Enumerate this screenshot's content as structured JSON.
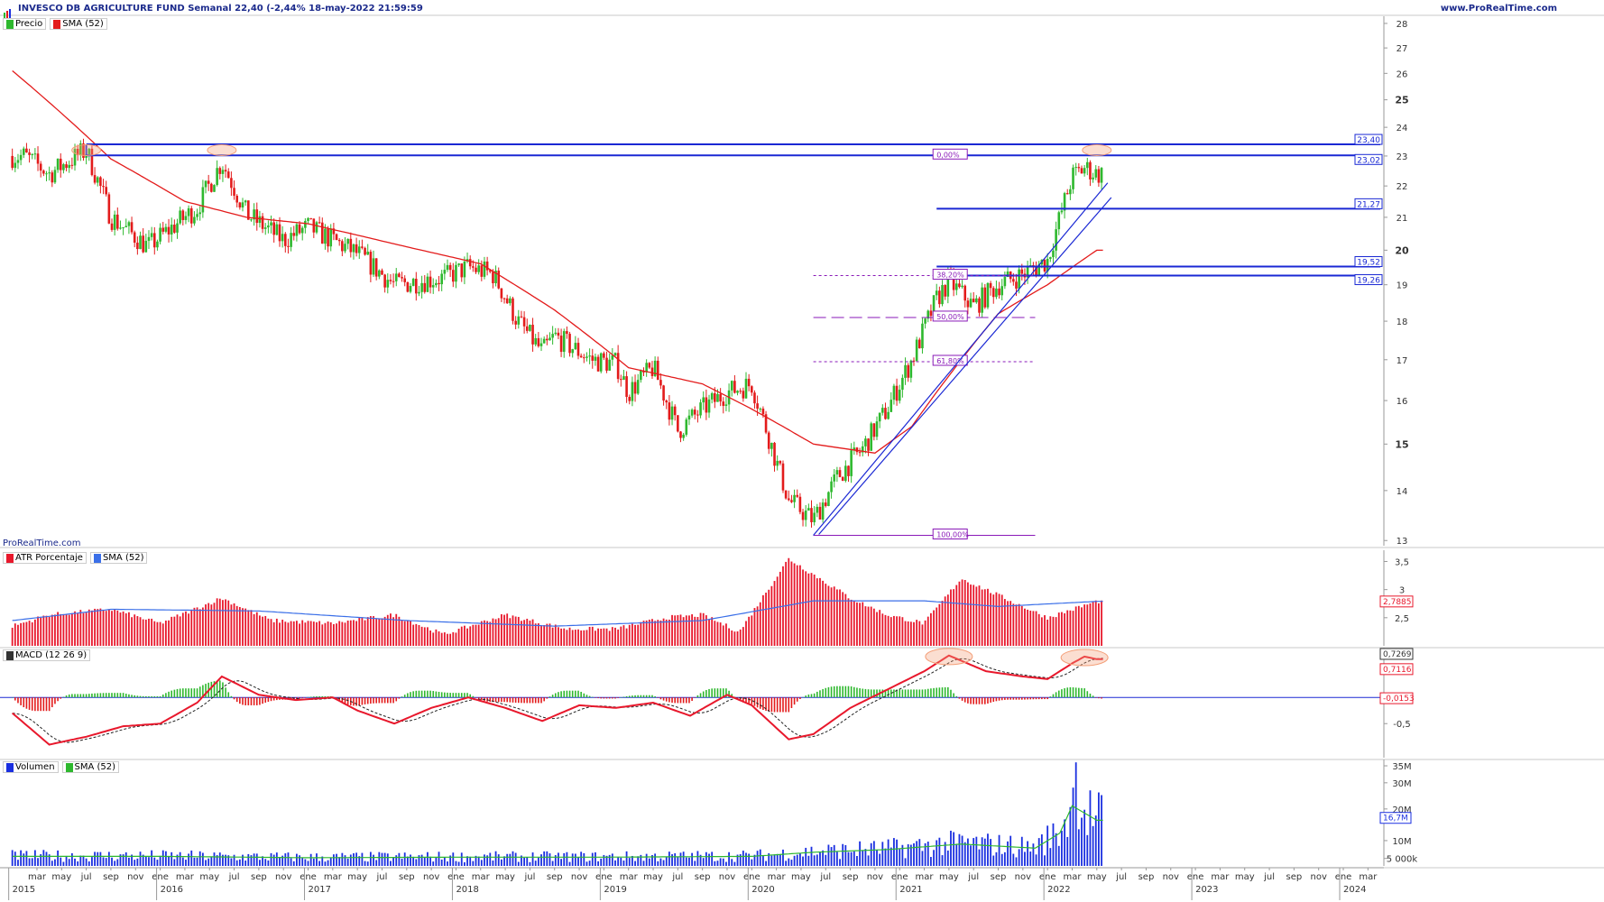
{
  "header": {
    "title": "INVESCO DB AGRICULTURE FUND Semanal 22,40 (-2,44% 18-may-2022 21:59:59",
    "credit": "www.ProRealTime.com",
    "watermark": "ProRealTime.com"
  },
  "colors": {
    "axis_text": "#333333",
    "frame": "#1b2a8c",
    "sma_price": "#e31b1b",
    "up_candle": "#2eb82e",
    "down_candle": "#e31b1b",
    "atr_bar": "#e8182c",
    "atr_sma": "#3a6fe8",
    "macd_line": "#e8182c",
    "signal_line": "#222222",
    "volume_bar": "#1a2fe0",
    "volume_sma": "#2eb82e",
    "level_line": "#1a28d4",
    "fib_line": "#8a1ab8",
    "highlight": "#f4a07a"
  },
  "legends": {
    "price": [
      {
        "label": "Precio",
        "color": "#2eb82e"
      },
      {
        "label": "SMA (52)",
        "color": "#e31b1b"
      }
    ],
    "atr": [
      {
        "label": "ATR Porcentaje",
        "color": "#e8182c"
      },
      {
        "label": "SMA (52)",
        "color": "#3a6fe8"
      }
    ],
    "macd": [
      {
        "label": "MACD (12 26 9)",
        "color": "#333333"
      }
    ],
    "volume": [
      {
        "label": "Volumen",
        "color": "#1a2fe0"
      },
      {
        "label": "SMA (52)",
        "color": "#2eb82e"
      }
    ]
  },
  "chart_data": [
    {
      "type": "candlestick",
      "panel": "price",
      "title": "INVESCO DB AGRICULTURE FUND Semanal",
      "last_close": 22.4,
      "change_pct": -2.44,
      "date": "18-may-2022 21:59:59",
      "y_scale": "log",
      "ylim": [
        12.9,
        28.3
      ],
      "y_ticks": [
        13,
        14,
        15,
        16,
        17,
        18,
        19,
        20,
        21,
        22,
        23,
        24,
        25,
        26,
        27,
        28
      ],
      "y_ticks_bold": [
        15,
        20,
        25
      ],
      "y_tick_labels": [
        "13",
        "14",
        "15",
        "16",
        "17",
        "18",
        "19",
        "20",
        "21",
        "22",
        "23",
        "24",
        "25",
        "26",
        "27",
        "28"
      ],
      "close_anchors": [
        {
          "date": "2015-02",
          "close": 23.0
        },
        {
          "date": "2015-04",
          "close": 22.4
        },
        {
          "date": "2015-07",
          "close": 23.2
        },
        {
          "date": "2015-09",
          "close": 21.0
        },
        {
          "date": "2015-12",
          "close": 20.1
        },
        {
          "date": "2016-04",
          "close": 21.3
        },
        {
          "date": "2016-06",
          "close": 22.8
        },
        {
          "date": "2016-08",
          "close": 21.1
        },
        {
          "date": "2016-11",
          "close": 20.3
        },
        {
          "date": "2017-01",
          "close": 20.7
        },
        {
          "date": "2017-05",
          "close": 19.9
        },
        {
          "date": "2017-08",
          "close": 19.0
        },
        {
          "date": "2017-12",
          "close": 19.2
        },
        {
          "date": "2018-02",
          "close": 19.5
        },
        {
          "date": "2018-04",
          "close": 19.3
        },
        {
          "date": "2018-06",
          "close": 18.0
        },
        {
          "date": "2018-08",
          "close": 17.2
        },
        {
          "date": "2018-09",
          "close": 17.6
        },
        {
          "date": "2018-12",
          "close": 17.0
        },
        {
          "date": "2019-02",
          "close": 16.9
        },
        {
          "date": "2019-03",
          "close": 16.2
        },
        {
          "date": "2019-05",
          "close": 16.8
        },
        {
          "date": "2019-07",
          "close": 15.3
        },
        {
          "date": "2019-09",
          "close": 15.8
        },
        {
          "date": "2019-11",
          "close": 16.2
        },
        {
          "date": "2020-01",
          "close": 16.4
        },
        {
          "date": "2020-03",
          "close": 14.6
        },
        {
          "date": "2020-04",
          "close": 13.8
        },
        {
          "date": "2020-06",
          "close": 13.4
        },
        {
          "date": "2020-08",
          "close": 14.3
        },
        {
          "date": "2020-10",
          "close": 14.9
        },
        {
          "date": "2020-12",
          "close": 15.8
        },
        {
          "date": "2021-02",
          "close": 17.0
        },
        {
          "date": "2021-04",
          "close": 18.6
        },
        {
          "date": "2021-05",
          "close": 19.1
        },
        {
          "date": "2021-07",
          "close": 18.4
        },
        {
          "date": "2021-09",
          "close": 19.0
        },
        {
          "date": "2021-11",
          "close": 19.3
        },
        {
          "date": "2022-01",
          "close": 19.7
        },
        {
          "date": "2022-03",
          "close": 22.3
        },
        {
          "date": "2022-04",
          "close": 22.6
        },
        {
          "date": "2022-05",
          "close": 22.4
        }
      ],
      "sma52_anchors": [
        {
          "date": "2015-01",
          "value": 26.1
        },
        {
          "date": "2015-09",
          "value": 22.9
        },
        {
          "date": "2016-03",
          "value": 21.5
        },
        {
          "date": "2016-08",
          "value": 21.0
        },
        {
          "date": "2017-01",
          "value": 20.8
        },
        {
          "date": "2017-09",
          "value": 20.1
        },
        {
          "date": "2018-03",
          "value": 19.6
        },
        {
          "date": "2018-09",
          "value": 18.3
        },
        {
          "date": "2019-03",
          "value": 16.8
        },
        {
          "date": "2019-09",
          "value": 16.4
        },
        {
          "date": "2020-01",
          "value": 15.8
        },
        {
          "date": "2020-06",
          "value": 15.0
        },
        {
          "date": "2020-11",
          "value": 14.8
        },
        {
          "date": "2021-02",
          "value": 15.4
        },
        {
          "date": "2021-05",
          "value": 16.6
        },
        {
          "date": "2021-09",
          "value": 18.2
        },
        {
          "date": "2022-01",
          "value": 19.0
        },
        {
          "date": "2022-05",
          "value": 20.0
        }
      ],
      "levels": [
        {
          "value": 23.4,
          "label": "23,40",
          "kind": "resistance"
        },
        {
          "value": 23.02,
          "label": "23,02",
          "kind": "resistance"
        },
        {
          "value": 21.27,
          "label": "21,27",
          "kind": "support"
        },
        {
          "value": 19.52,
          "label": "19,52",
          "kind": "support"
        },
        {
          "value": 19.26,
          "label": "19,26",
          "kind": "support"
        }
      ],
      "fibonacci": [
        {
          "label": "0,00%",
          "value": 23.02
        },
        {
          "label": "38,20%",
          "value": 19.26
        },
        {
          "label": "50,00%",
          "value": 18.1
        },
        {
          "label": "61,80%",
          "value": 16.95
        },
        {
          "label": "100,00%",
          "value": 13.1
        }
      ],
      "trend_channel": [
        {
          "from": {
            "date": "2020-06",
            "value": 13.1
          },
          "to": {
            "date": "2022-05",
            "value": 22.1
          }
        },
        {
          "from": {
            "date": "2020-06",
            "value": 13.1
          },
          "to": {
            "date": "2022-05",
            "value": 21.8
          }
        }
      ],
      "highlights": [
        "2015-07",
        "2016-06",
        "2022-05"
      ]
    },
    {
      "type": "bar",
      "panel": "atr",
      "title": "ATR Porcentaje",
      "last_value": 2.7885,
      "last_label": "2,7885",
      "ylim": [
        2.0,
        3.7
      ],
      "y_ticks": [
        2.5,
        3,
        3.5
      ],
      "y_tick_labels": [
        "2,5",
        "3",
        "3,5"
      ],
      "anchors": [
        {
          "date": "2015-01",
          "value": 2.35
        },
        {
          "date": "2015-04",
          "value": 2.55
        },
        {
          "date": "2015-09",
          "value": 2.65
        },
        {
          "date": "2016-01",
          "value": 2.4
        },
        {
          "date": "2016-06",
          "value": 2.85
        },
        {
          "date": "2016-10",
          "value": 2.45
        },
        {
          "date": "2017-03",
          "value": 2.4
        },
        {
          "date": "2017-08",
          "value": 2.55
        },
        {
          "date": "2017-12",
          "value": 2.2
        },
        {
          "date": "2018-05",
          "value": 2.55
        },
        {
          "date": "2018-10",
          "value": 2.3
        },
        {
          "date": "2019-02",
          "value": 2.3
        },
        {
          "date": "2019-06",
          "value": 2.5
        },
        {
          "date": "2019-09",
          "value": 2.55
        },
        {
          "date": "2019-12",
          "value": 2.25
        },
        {
          "date": "2020-04",
          "value": 3.55
        },
        {
          "date": "2020-09",
          "value": 2.85
        },
        {
          "date": "2020-12",
          "value": 2.55
        },
        {
          "date": "2021-03",
          "value": 2.4
        },
        {
          "date": "2021-06",
          "value": 3.2
        },
        {
          "date": "2021-10",
          "value": 2.8
        },
        {
          "date": "2022-01",
          "value": 2.5
        },
        {
          "date": "2022-05",
          "value": 2.79
        }
      ],
      "sma52_anchors": [
        {
          "date": "2015-01",
          "value": 2.45
        },
        {
          "date": "2015-09",
          "value": 2.65
        },
        {
          "date": "2016-09",
          "value": 2.62
        },
        {
          "date": "2017-09",
          "value": 2.45
        },
        {
          "date": "2018-09",
          "value": 2.35
        },
        {
          "date": "2019-09",
          "value": 2.45
        },
        {
          "date": "2020-06",
          "value": 2.8
        },
        {
          "date": "2021-03",
          "value": 2.8
        },
        {
          "date": "2021-09",
          "value": 2.7
        },
        {
          "date": "2022-05",
          "value": 2.79
        }
      ]
    },
    {
      "type": "line",
      "panel": "macd",
      "title": "MACD (12 26 9)",
      "values_labels": [
        "0,7269",
        "0,7116",
        "-0,0153"
      ],
      "macd_last": 0.7269,
      "signal_last": 0.7116,
      "histogram_last": -0.0153,
      "ylim": [
        -1.15,
        0.95
      ],
      "y_ticks": [
        -0.5
      ],
      "y_tick_labels": [
        "-0,5"
      ],
      "macd_anchors": [
        {
          "date": "2015-01",
          "value": -0.3
        },
        {
          "date": "2015-04",
          "value": -0.9
        },
        {
          "date": "2015-07",
          "value": -0.75
        },
        {
          "date": "2015-10",
          "value": -0.55
        },
        {
          "date": "2016-01",
          "value": -0.5
        },
        {
          "date": "2016-04",
          "value": -0.1
        },
        {
          "date": "2016-06",
          "value": 0.4
        },
        {
          "date": "2016-09",
          "value": 0.05
        },
        {
          "date": "2016-12",
          "value": -0.05
        },
        {
          "date": "2017-03",
          "value": 0.0
        },
        {
          "date": "2017-05",
          "value": -0.25
        },
        {
          "date": "2017-08",
          "value": -0.5
        },
        {
          "date": "2017-11",
          "value": -0.2
        },
        {
          "date": "2018-02",
          "value": 0.0
        },
        {
          "date": "2018-05",
          "value": -0.2
        },
        {
          "date": "2018-08",
          "value": -0.45
        },
        {
          "date": "2018-11",
          "value": -0.15
        },
        {
          "date": "2019-02",
          "value": -0.2
        },
        {
          "date": "2019-05",
          "value": -0.1
        },
        {
          "date": "2019-08",
          "value": -0.35
        },
        {
          "date": "2019-11",
          "value": 0.05
        },
        {
          "date": "2020-01",
          "value": -0.15
        },
        {
          "date": "2020-04",
          "value": -0.8
        },
        {
          "date": "2020-06",
          "value": -0.7
        },
        {
          "date": "2020-09",
          "value": -0.2
        },
        {
          "date": "2020-12",
          "value": 0.15
        },
        {
          "date": "2021-03",
          "value": 0.5
        },
        {
          "date": "2021-05",
          "value": 0.8
        },
        {
          "date": "2021-08",
          "value": 0.5
        },
        {
          "date": "2021-11",
          "value": 0.4
        },
        {
          "date": "2022-01",
          "value": 0.35
        },
        {
          "date": "2022-03",
          "value": 0.65
        },
        {
          "date": "2022-04",
          "value": 0.78
        },
        {
          "date": "2022-05",
          "value": 0.73
        }
      ]
    },
    {
      "type": "bar",
      "panel": "volume",
      "title": "Volumen",
      "last_label": "16,7M",
      "ylim": [
        0,
        37000000
      ],
      "y_ticks": [
        5000000,
        10000000,
        20000000,
        30000000,
        35000000
      ],
      "y_tick_labels": [
        "5 000k",
        "10M",
        "20M",
        "30M",
        "35M"
      ],
      "y_tick_pos": [
        2600000,
        8800000,
        19800000,
        28900000,
        34800000
      ],
      "anchors": [
        {
          "date": "2015-01",
          "value": 3500000
        },
        {
          "date": "2016-01",
          "value": 3500000
        },
        {
          "date": "2017-01",
          "value": 3000000
        },
        {
          "date": "2018-01",
          "value": 3200000
        },
        {
          "date": "2019-01",
          "value": 3200000
        },
        {
          "date": "2020-01",
          "value": 3500000
        },
        {
          "date": "2020-06",
          "value": 5000000
        },
        {
          "date": "2020-12",
          "value": 6000000
        },
        {
          "date": "2021-06",
          "value": 8000000
        },
        {
          "date": "2021-12",
          "value": 6500000
        },
        {
          "date": "2022-02",
          "value": 12000000
        },
        {
          "date": "2022-03",
          "value": 22000000
        },
        {
          "date": "2022-05",
          "value": 16700000
        }
      ],
      "spike": {
        "date": "2022-03",
        "value": 36000000
      }
    }
  ],
  "x_axis": {
    "month_ticks": [
      {
        "date": "2015-03",
        "label": "mar"
      },
      {
        "date": "2015-05",
        "label": "may"
      },
      {
        "date": "2015-07",
        "label": "jul"
      },
      {
        "date": "2015-09",
        "label": "sep"
      },
      {
        "date": "2015-11",
        "label": "nov"
      },
      {
        "date": "2016-01",
        "label": "ene"
      },
      {
        "date": "2016-03",
        "label": "mar"
      },
      {
        "date": "2016-05",
        "label": "may"
      },
      {
        "date": "2016-07",
        "label": "jul"
      },
      {
        "date": "2016-09",
        "label": "sep"
      },
      {
        "date": "2016-11",
        "label": "nov"
      },
      {
        "date": "2017-01",
        "label": "ene"
      },
      {
        "date": "2017-03",
        "label": "mar"
      },
      {
        "date": "2017-05",
        "label": "may"
      },
      {
        "date": "2017-07",
        "label": "jul"
      },
      {
        "date": "2017-09",
        "label": "sep"
      },
      {
        "date": "2017-11",
        "label": "nov"
      },
      {
        "date": "2018-01",
        "label": "ene"
      },
      {
        "date": "2018-03",
        "label": "mar"
      },
      {
        "date": "2018-05",
        "label": "may"
      },
      {
        "date": "2018-07",
        "label": "jul"
      },
      {
        "date": "2018-09",
        "label": "sep"
      },
      {
        "date": "2018-11",
        "label": "nov"
      },
      {
        "date": "2019-01",
        "label": "ene"
      },
      {
        "date": "2019-03",
        "label": "mar"
      },
      {
        "date": "2019-05",
        "label": "may"
      },
      {
        "date": "2019-07",
        "label": "jul"
      },
      {
        "date": "2019-09",
        "label": "sep"
      },
      {
        "date": "2019-11",
        "label": "nov"
      },
      {
        "date": "2020-01",
        "label": "ene"
      },
      {
        "date": "2020-03",
        "label": "mar"
      },
      {
        "date": "2020-05",
        "label": "may"
      },
      {
        "date": "2020-07",
        "label": "jul"
      },
      {
        "date": "2020-09",
        "label": "sep"
      },
      {
        "date": "2020-11",
        "label": "nov"
      },
      {
        "date": "2021-01",
        "label": "ene"
      },
      {
        "date": "2021-03",
        "label": "mar"
      },
      {
        "date": "2021-05",
        "label": "may"
      },
      {
        "date": "2021-07",
        "label": "jul"
      },
      {
        "date": "2021-09",
        "label": "sep"
      },
      {
        "date": "2021-11",
        "label": "nov"
      },
      {
        "date": "2022-01",
        "label": "ene"
      },
      {
        "date": "2022-03",
        "label": "mar"
      },
      {
        "date": "2022-05",
        "label": "may"
      },
      {
        "date": "2022-07",
        "label": "jul"
      },
      {
        "date": "2022-09",
        "label": "sep"
      },
      {
        "date": "2022-11",
        "label": "nov"
      },
      {
        "date": "2023-01",
        "label": "ene"
      },
      {
        "date": "2023-03",
        "label": "mar"
      },
      {
        "date": "2023-05",
        "label": "may"
      },
      {
        "date": "2023-07",
        "label": "jul"
      },
      {
        "date": "2023-09",
        "label": "sep"
      },
      {
        "date": "2023-11",
        "label": "nov"
      },
      {
        "date": "2024-01",
        "label": "ene"
      },
      {
        "date": "2024-03",
        "label": "mar"
      }
    ],
    "year_ticks": [
      {
        "date": "2015-01",
        "label": "2015"
      },
      {
        "date": "2016-01",
        "label": "2016"
      },
      {
        "date": "2017-01",
        "label": "2017"
      },
      {
        "date": "2018-01",
        "label": "2018"
      },
      {
        "date": "2019-01",
        "label": "2019"
      },
      {
        "date": "2020-01",
        "label": "2020"
      },
      {
        "date": "2021-01",
        "label": "2021"
      },
      {
        "date": "2022-01",
        "label": "2022"
      },
      {
        "date": "2023-01",
        "label": "2023"
      },
      {
        "date": "2024-01",
        "label": "2024"
      }
    ],
    "range": [
      "2014-12",
      "2024-04"
    ]
  }
}
